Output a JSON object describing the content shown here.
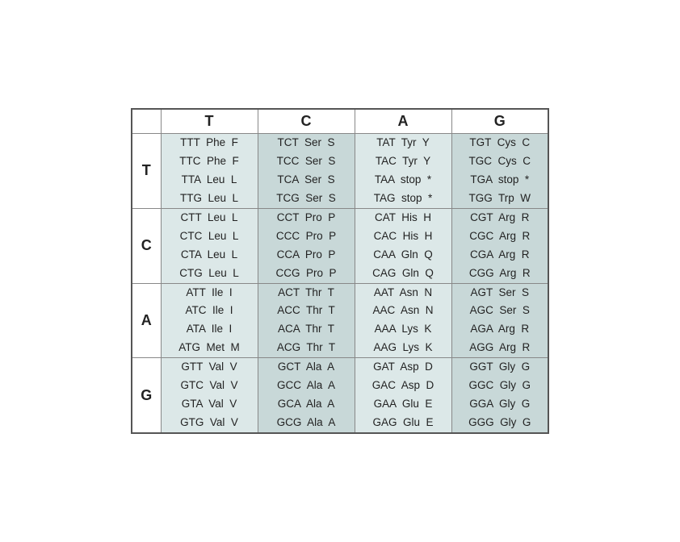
{
  "table": {
    "col_headers": [
      "T",
      "C",
      "A",
      "G"
    ],
    "row_headers": [
      "T",
      "C",
      "A",
      "G"
    ],
    "cells": [
      [
        [
          "TTT  Phe  F",
          "TTC  Phe  F",
          "TTA  Leu  L",
          "TTG  Leu  L"
        ],
        [
          "TCT  Ser  S",
          "TCC  Ser  S",
          "TCA  Ser  S",
          "TCG  Ser  S"
        ],
        [
          "TAT  Tyr  Y",
          "TAC  Tyr  Y",
          "TAA  stop  *",
          "TAG  stop  *"
        ],
        [
          "TGT  Cys  C",
          "TGC  Cys  C",
          "TGA  stop  *",
          "TGG  Trp  W"
        ]
      ],
      [
        [
          "CTT  Leu  L",
          "CTC  Leu  L",
          "CTA  Leu  L",
          "CTG  Leu  L"
        ],
        [
          "CCT  Pro  P",
          "CCC  Pro  P",
          "CCA  Pro  P",
          "CCG  Pro  P"
        ],
        [
          "CAT  His  H",
          "CAC  His  H",
          "CAA  Gln  Q",
          "CAG  Gln  Q"
        ],
        [
          "CGT  Arg  R",
          "CGC  Arg  R",
          "CGA  Arg  R",
          "CGG  Arg  R"
        ]
      ],
      [
        [
          "ATT  Ile  I",
          "ATC  Ile  I",
          "ATA  Ile  I",
          "ATG  Met  M"
        ],
        [
          "ACT  Thr  T",
          "ACC  Thr  T",
          "ACA  Thr  T",
          "ACG  Thr  T"
        ],
        [
          "AAT  Asn  N",
          "AAC  Asn  N",
          "AAA  Lys  K",
          "AAG  Lys  K"
        ],
        [
          "AGT  Ser  S",
          "AGC  Ser  S",
          "AGA  Arg  R",
          "AGG  Arg  R"
        ]
      ],
      [
        [
          "GTT  Val  V",
          "GTC  Val  V",
          "GTA  Val  V",
          "GTG  Val  V"
        ],
        [
          "GCT  Ala  A",
          "GCC  Ala  A",
          "GCA  Ala  A",
          "GCG  Ala  A"
        ],
        [
          "GAT  Asp  D",
          "GAC  Asp  D",
          "GAA  Glu  E",
          "GAG  Glu  E"
        ],
        [
          "GGT  Gly  G",
          "GGC  Gly  G",
          "GGA  Gly  G",
          "GGG  Gly  G"
        ]
      ]
    ]
  }
}
